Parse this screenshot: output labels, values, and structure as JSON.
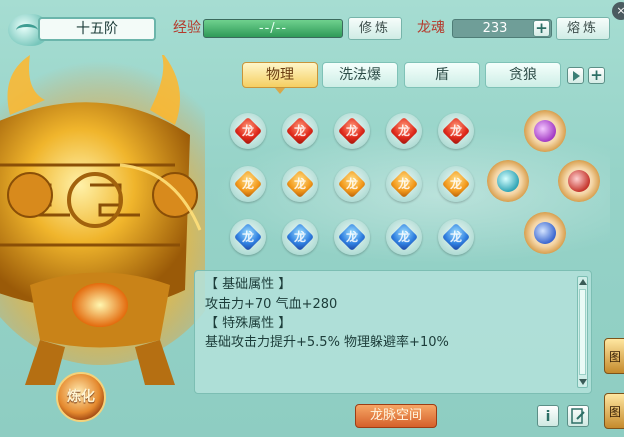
{
  "header": {
    "rank_label": "十五阶",
    "exp_label": "经验",
    "exp_value": "--/--",
    "exp_fill_fraction": 1.0,
    "train_button": "修炼",
    "soul_label": "龙魂",
    "soul_value": "233",
    "smelt_button": "熔炼",
    "plus_symbol": "+"
  },
  "tabs": [
    {
      "label": "物理",
      "active": true
    },
    {
      "label": "洗法爆",
      "active": false
    },
    {
      "label": "盾",
      "active": false
    },
    {
      "label": "贪狼",
      "active": false
    }
  ],
  "tab_controls": {
    "next_icon": "arrow-right-icon",
    "add_symbol": "+"
  },
  "gems": {
    "rows": [
      {
        "color": "red",
        "count": 5
      },
      {
        "color": "orange",
        "count": 5
      },
      {
        "color": "blue",
        "count": 5
      }
    ],
    "glyph": "龙",
    "star_gems": [
      {
        "color": "purple"
      },
      {
        "color": "teal"
      },
      {
        "color": "red"
      },
      {
        "color": "blue"
      }
    ]
  },
  "info": {
    "basic_header": "【 基础属性 】",
    "basic_stats": "攻击力+70   气血+280",
    "special_header": "【 特殊属性 】",
    "special_stats": "基础攻击力提升+5.5%   物理躲避率+10%"
  },
  "buttons": {
    "refine": "炼化",
    "dragon_space": "龙脉空间",
    "info_icon": "info-icon",
    "edit_icon": "edit-icon",
    "info_glyph": "i",
    "side_top": "图",
    "side_bottom": "图"
  },
  "colors": {
    "exp_bar": "#2f9a58",
    "active_tab": "#f5cf62",
    "refine_button": "#e58a2f"
  }
}
